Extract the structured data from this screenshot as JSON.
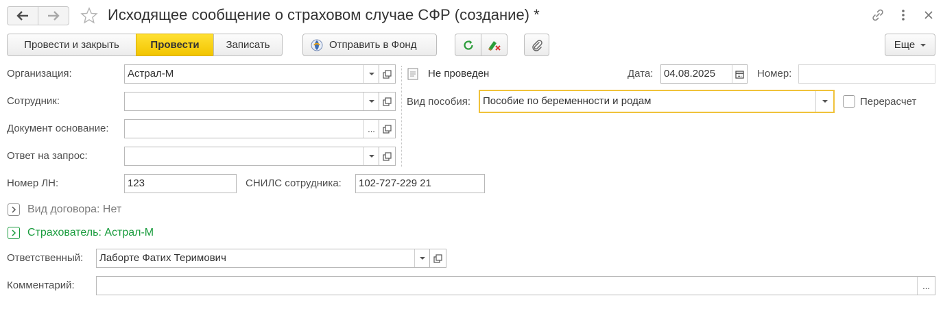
{
  "window": {
    "title": "Исходящее сообщение о страховом случае СФР (создание) *",
    "icons": [
      "back-arrow-icon",
      "forward-arrow-icon",
      "favorite-star-icon",
      "link-icon",
      "more-vertical-icon",
      "close-icon"
    ]
  },
  "toolbar": {
    "post_and_close": "Провести и закрыть",
    "post": "Провести",
    "save": "Записать",
    "send_to_fund": "Отправить в Фонд",
    "more": "Еще"
  },
  "colors": {
    "primary_button": "#f2c500",
    "focus_border": "#f0c23a",
    "green_link": "#1a9c3e",
    "refresh_icon": "#2b9c3a",
    "clear_icon_red": "#d93030"
  },
  "form": {
    "organization": {
      "label": "Организация:",
      "value": "Астрал-М"
    },
    "employee": {
      "label": "Сотрудник:",
      "value": ""
    },
    "base_document": {
      "label": "Документ основание:",
      "value": "",
      "button": "..."
    },
    "response_to_request": {
      "label": "Ответ на запрос:",
      "value": ""
    },
    "status": "Не проведен",
    "date": {
      "label": "Дата:",
      "value": "04.08.2025"
    },
    "number": {
      "label": "Номер:",
      "value": ""
    },
    "benefit_type": {
      "label": "Вид пособия:",
      "value": "Пособие по беременности и родам"
    },
    "recalculation": {
      "label": "Перерасчет",
      "checked": false
    },
    "ln_number": {
      "label": "Номер ЛН:",
      "value": "123"
    },
    "snils": {
      "label": "СНИЛС сотрудника:",
      "value": "102-727-229 21"
    },
    "contract_type": "Вид договора: Нет",
    "insurer": "Страхователь: Астрал-М",
    "responsible": {
      "label": "Ответственный:",
      "value": "Лаборте Фатих Теримович"
    },
    "comment": {
      "label": "Комментарий:",
      "value": "",
      "button": "..."
    }
  }
}
